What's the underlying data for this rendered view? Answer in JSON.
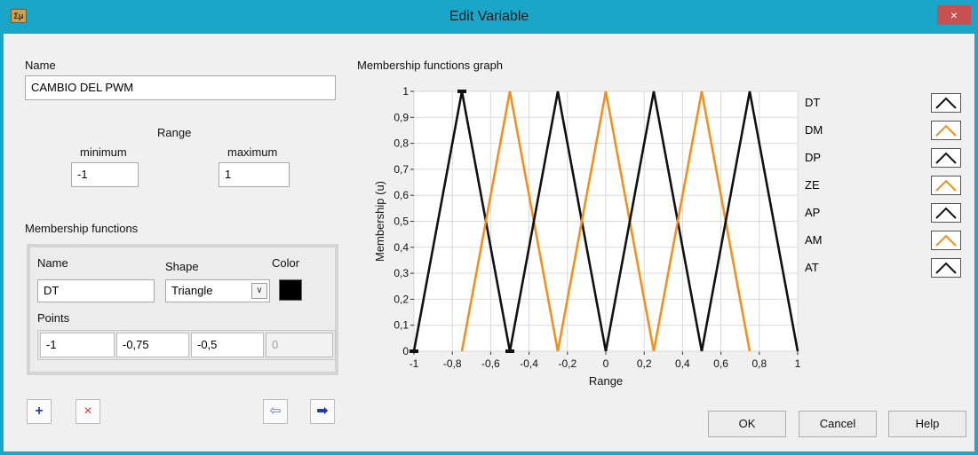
{
  "window": {
    "title": "Edit Variable",
    "app_icon": "Σμ",
    "close": "×"
  },
  "name_section": {
    "label": "Name",
    "value": "CAMBIO DEL PWM"
  },
  "range": {
    "label": "Range",
    "min_label": "minimum",
    "max_label": "maximum",
    "min_value": "-1",
    "max_value": "1"
  },
  "mf": {
    "section_label": "Membership functions",
    "name_label": "Name",
    "name_value": "DT",
    "shape_label": "Shape",
    "shape_value": "Triangle",
    "color_label": "Color",
    "color_value": "#000000",
    "points_label": "Points",
    "points": [
      "-1",
      "-0,75",
      "-0,5",
      "0"
    ]
  },
  "buttons": {
    "add": "+",
    "delete": "×",
    "prev": "⇦",
    "next": "➡",
    "ok": "OK",
    "cancel": "Cancel",
    "help": "Help"
  },
  "graph": {
    "title": "Membership functions graph",
    "y_label": "Membership (u)",
    "x_label": "Range",
    "legend": [
      {
        "name": "DT",
        "color": "#111111"
      },
      {
        "name": "DM",
        "color": "#f0901f"
      },
      {
        "name": "DP",
        "color": "#111111"
      },
      {
        "name": "ZE",
        "color": "#f0901f"
      },
      {
        "name": "AP",
        "color": "#111111"
      },
      {
        "name": "AM",
        "color": "#f0901f"
      },
      {
        "name": "AT",
        "color": "#111111"
      }
    ]
  },
  "chart_data": {
    "type": "line",
    "title": "Membership functions graph",
    "xlabel": "Range",
    "ylabel": "Membership (u)",
    "xlim": [
      -1,
      1
    ],
    "ylim": [
      0,
      1
    ],
    "x_ticks": [
      "-1",
      "-0,8",
      "-0,6",
      "-0,4",
      "-0,2",
      "0",
      "0,2",
      "0,4",
      "0,6",
      "0,8",
      "1"
    ],
    "y_ticks": [
      "0",
      "0,1",
      "0,2",
      "0,3",
      "0,4",
      "0,5",
      "0,6",
      "0,7",
      "0,8",
      "0,9",
      "1"
    ],
    "grid": true,
    "series": [
      {
        "name": "DT",
        "color": "#111111",
        "x": [
          -1,
          -0.75,
          -0.5
        ],
        "y": [
          0,
          1,
          0
        ]
      },
      {
        "name": "DM",
        "color": "#f0901f",
        "x": [
          -0.75,
          -0.5,
          -0.25
        ],
        "y": [
          0,
          1,
          0
        ]
      },
      {
        "name": "DP",
        "color": "#111111",
        "x": [
          -0.5,
          -0.25,
          0
        ],
        "y": [
          0,
          1,
          0
        ]
      },
      {
        "name": "ZE",
        "color": "#f0901f",
        "x": [
          -0.25,
          0,
          0.25
        ],
        "y": [
          0,
          1,
          0
        ]
      },
      {
        "name": "AP",
        "color": "#111111",
        "x": [
          0,
          0.25,
          0.5
        ],
        "y": [
          0,
          1,
          0
        ]
      },
      {
        "name": "AM",
        "color": "#f0901f",
        "x": [
          0.25,
          0.5,
          0.75
        ],
        "y": [
          0,
          1,
          0
        ]
      },
      {
        "name": "AT",
        "color": "#111111",
        "x": [
          0.5,
          0.75,
          1
        ],
        "y": [
          0,
          1,
          0
        ]
      }
    ]
  }
}
